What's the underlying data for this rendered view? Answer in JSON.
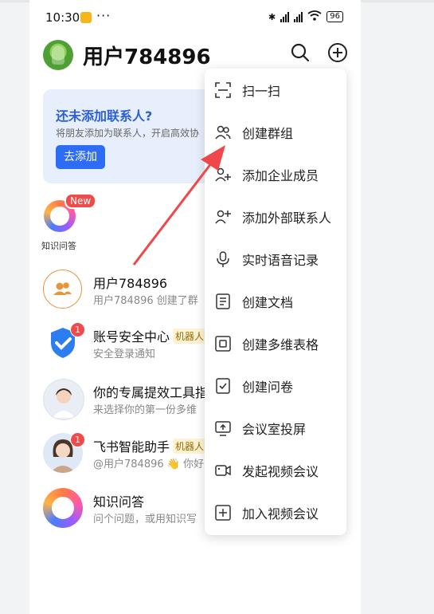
{
  "status_bar": {
    "time": "10:30",
    "dots": "···",
    "battery": "96"
  },
  "header": {
    "title": "用户784896"
  },
  "invite_card": {
    "title": "还未添加联系人?",
    "description": "将朋友添加为联系人，开启高效协",
    "button": "去添加"
  },
  "apps": [
    {
      "label": "知识问答",
      "badge": "New"
    }
  ],
  "chats": [
    {
      "name": "用户784896",
      "preview": "用户784896 创建了群",
      "tag": "",
      "badge": ""
    },
    {
      "name": "账号安全中心",
      "preview": "安全登录通知",
      "tag": "机器人",
      "badge": "1"
    },
    {
      "name": "你的专属提效工具指",
      "preview": "来选择你的第一份多维",
      "tag": "",
      "badge": ""
    },
    {
      "name": "飞书智能助手",
      "preview": "@用户784896 👋 你好",
      "tag": "机器人",
      "badge": "1"
    },
    {
      "name": "知识问答",
      "preview": "问个问题，或用知识写",
      "tag": "",
      "badge": ""
    }
  ],
  "menu": {
    "items": [
      {
        "label": "扫一扫",
        "icon": "scan-icon"
      },
      {
        "label": "创建群组",
        "icon": "group-icon"
      },
      {
        "label": "添加企业成员",
        "icon": "add-members-icon"
      },
      {
        "label": "添加外部联系人",
        "icon": "add-contact-icon"
      },
      {
        "label": "实时语音记录",
        "icon": "microphone-icon"
      },
      {
        "label": "创建文档",
        "icon": "document-icon"
      },
      {
        "label": "创建多维表格",
        "icon": "base-table-icon"
      },
      {
        "label": "创建问卷",
        "icon": "survey-icon"
      },
      {
        "label": "会议室投屏",
        "icon": "screen-share-icon"
      },
      {
        "label": "发起视频会议",
        "icon": "video-icon"
      },
      {
        "label": "加入视频会议",
        "icon": "join-meeting-icon"
      }
    ]
  },
  "colors": {
    "accent": "#2f6cf5",
    "badge": "#f04b4b",
    "annotation_arrow": "#f0474a"
  }
}
